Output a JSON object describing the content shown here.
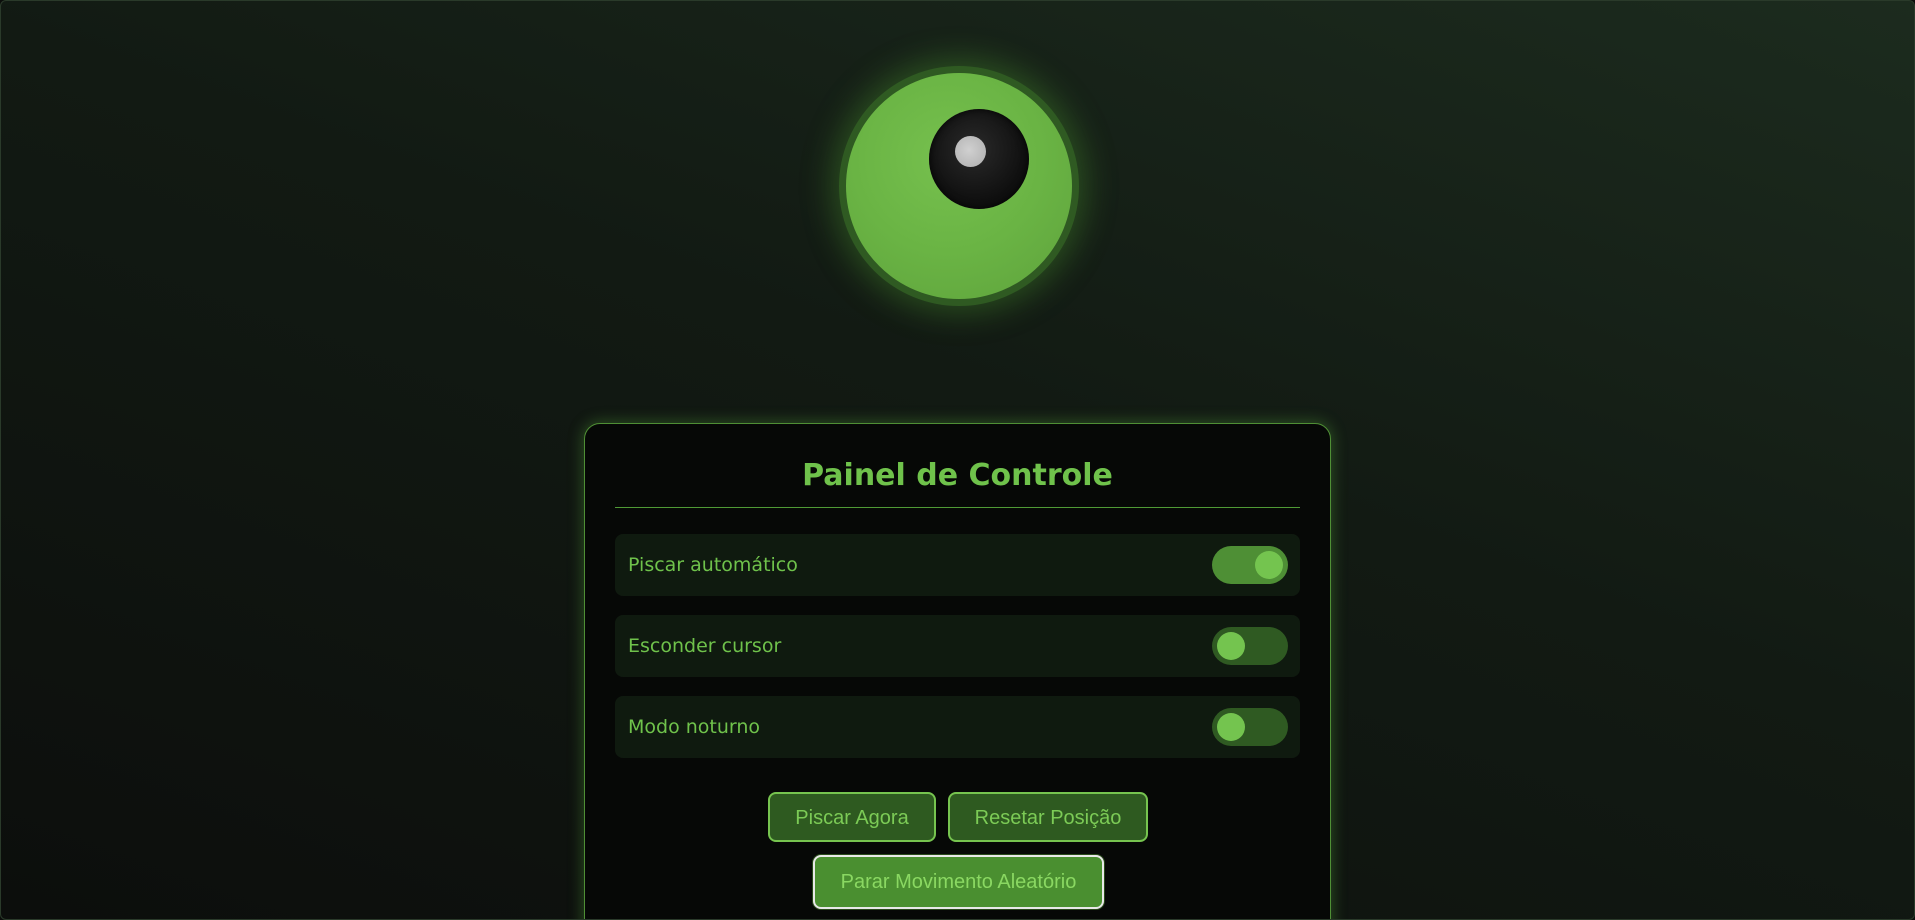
{
  "panel": {
    "title": "Painel de Controle",
    "settings": [
      {
        "label": "Piscar automático",
        "enabled": true
      },
      {
        "label": "Esconder cursor",
        "enabled": false
      },
      {
        "label": "Modo noturno",
        "enabled": false
      }
    ],
    "buttons": {
      "blink_now": "Piscar Agora",
      "reset_position": "Resetar Posição",
      "stop_random": "Parar Movimento Aleatório"
    }
  },
  "colors": {
    "accent": "#6fc24b",
    "iris": "#6ab444",
    "panel_bg": "#060806"
  }
}
